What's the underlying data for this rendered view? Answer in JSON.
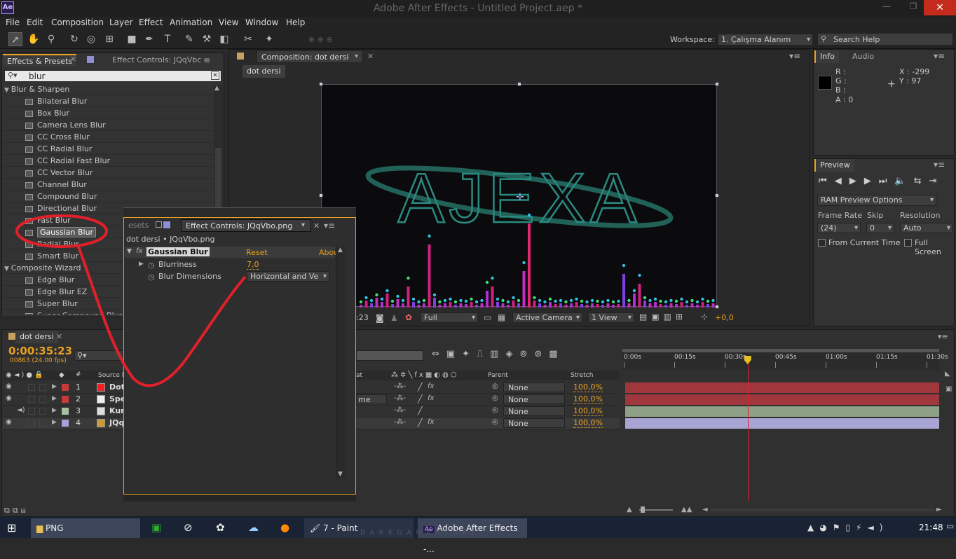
{
  "window": {
    "title": "Adobe After Effects - Untitled Project.aep *",
    "app_icon": "Ae"
  },
  "menu": [
    "File",
    "Edit",
    "Composition",
    "Layer",
    "Effect",
    "Animation",
    "View",
    "Window",
    "Help"
  ],
  "workspace": {
    "label": "Workspace:",
    "value": "1. Çalışma Alanım",
    "search_placeholder": "Search Help"
  },
  "effects_presets": {
    "tab_label": "Effects & Presets",
    "tab2_label": "Effect Controls: JQqVbc",
    "search_value": "blur",
    "groups": [
      {
        "name": "Blur & Sharpen",
        "items": [
          "Bilateral Blur",
          "Box Blur",
          "Camera Lens Blur",
          "CC Cross Blur",
          "CC Radial Blur",
          "CC Radial Fast Blur",
          "CC Vector Blur",
          "Channel Blur",
          "Compound Blur",
          "Directional Blur",
          "Fast Blur",
          "Gaussian Blur",
          "Radial Blur",
          "Smart Blur"
        ]
      },
      {
        "name": "Composite Wizard",
        "items": [
          "Edge Blur",
          "Edge Blur EZ",
          "Super Blur",
          "Super Compound Blur"
        ]
      }
    ],
    "selected_item": "Gaussian Blur"
  },
  "effect_controls": {
    "tab_prefix": "esets",
    "tab_label": "Effect Controls: JQqVbo.png",
    "header": "dot dersi • JQqVbo.png",
    "effect_name": "Gaussian Blur",
    "reset": "Reset",
    "about": "Abou",
    "fx": "fx",
    "props": [
      {
        "name": "Blurriness",
        "value": "7,0"
      },
      {
        "name": "Blur Dimensions",
        "value": "Horizontal and Ve"
      }
    ]
  },
  "composition": {
    "tab_label": "Composition: dot dersi",
    "sub_tab": "dot dersi",
    "canvas_text": "AJEXA",
    "bottom": {
      "timecode": ":23",
      "quality": "Full",
      "camera": "Active Camera",
      "views": "1 View",
      "offset": "+0,0"
    }
  },
  "info": {
    "tab_info": "Info",
    "tab_audio": "Audio",
    "r": "R :",
    "g": "G :",
    "b": "B :",
    "a": "A : 0",
    "x": "X : -299",
    "y": "Y : 97"
  },
  "preview": {
    "tab": "Preview",
    "ram": "RAM Preview Options",
    "frame_rate_label": "Frame Rate",
    "frame_rate": "(24)",
    "skip_label": "Skip",
    "skip": "0",
    "resolution_label": "Resolution",
    "resolution": "Auto",
    "from_current": "From Current Time",
    "full_screen": "Full Screen"
  },
  "timeline": {
    "tab": "dot dersi",
    "timecode": "0:00:35:23",
    "fps": "00863 (24.00 fps)",
    "col_hash": "#",
    "col_source": "Source N",
    "col_mat": "at",
    "col_parent": "Parent",
    "col_stretch": "Stretch",
    "ruler": [
      "0:00s",
      "00:15s",
      "00:30s",
      "00:45s",
      "01:00s",
      "01:15s",
      "01:30s"
    ],
    "playhead_fraction": 0.39,
    "layers": [
      {
        "num": "1",
        "name": "Dot",
        "label_color": "#c83a3a",
        "parent": "None",
        "stretch": "100,0%",
        "bar_color": "#a0373c",
        "fx": "fx"
      },
      {
        "num": "2",
        "name": "Spe",
        "label_color": "#c83a3a",
        "parent": "None",
        "stretch": "100,0%",
        "bar_color": "#a0373c",
        "fx": "fx",
        "mode": "me"
      },
      {
        "num": "3",
        "name": "Kur",
        "label_color": "#a9c0a0",
        "parent": "None",
        "stretch": "100,0%",
        "bar_color": "#8ea186",
        "fx": ""
      },
      {
        "num": "4",
        "name": "JQq",
        "label_color": "#a8a0d8",
        "parent": "None",
        "stretch": "100,0%",
        "bar_color": "#a8a4d4",
        "fx": "fx"
      }
    ]
  },
  "taskbar": {
    "items": [
      "PNG",
      "7 - Paint",
      "Adobe After Effects -..."
    ],
    "clock": "21:48",
    "watermark": "D A R K G A M E R T U B E"
  },
  "colors": {
    "accent": "#e8a020",
    "annotation": "#e0202a",
    "teal": "#2a8a80"
  }
}
